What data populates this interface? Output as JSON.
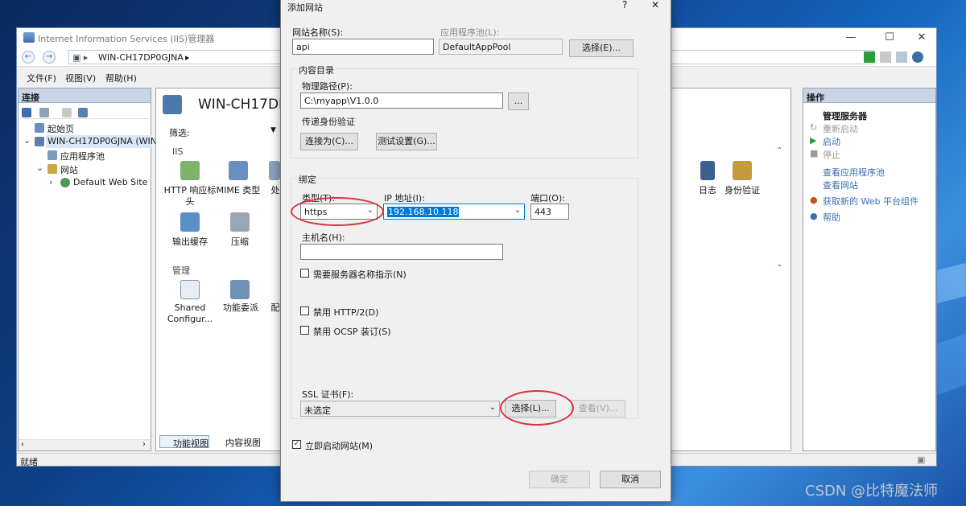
{
  "window": {
    "title": "Internet Information Services (IIS)管理器",
    "address_parts": [
      "WIN-CH17DP0GJNA"
    ],
    "menu": [
      "文件(F)",
      "视图(V)",
      "帮助(H)"
    ]
  },
  "connections": {
    "title": "连接",
    "tree": [
      {
        "label": "起始页"
      },
      {
        "label": "WIN-CH17DP0GJNA (WIN-"
      },
      {
        "label": "应用程序池"
      },
      {
        "label": "网站"
      },
      {
        "label": "Default Web Site"
      }
    ]
  },
  "center": {
    "title": "WIN-CH17DP",
    "filter_label": "筛选:",
    "group_iis": "IIS",
    "group_manage": "管理",
    "features": [
      {
        "label": "HTTP 响应标头"
      },
      {
        "label": "MIME 类型"
      },
      {
        "label": "处"
      },
      {
        "label": "输出缓存"
      },
      {
        "label": "压缩"
      },
      {
        "label": "日志"
      },
      {
        "label": "身份验证"
      },
      {
        "label": "Shared Configur..."
      },
      {
        "label": "功能委派"
      },
      {
        "label": "配"
      }
    ],
    "tabs": [
      "功能视图",
      "内容视图"
    ]
  },
  "actions": {
    "title": "操作",
    "manage_server": "管理服务器",
    "restart": "重新启动",
    "start": "启动",
    "stop": "停止",
    "view_app_pools": "查看应用程序池",
    "view_sites": "查看网站",
    "get_new": "获取新的 Web 平台组件",
    "help": "帮助"
  },
  "status": {
    "text": "就绪"
  },
  "dialog": {
    "title": "添加网站",
    "help": "?",
    "close": "✕",
    "site_name_label": "网站名称(S):",
    "site_name_value": "api",
    "app_pool_label": "应用程序池(L):",
    "app_pool_value": "DefaultAppPool",
    "select_e": "选择(E)...",
    "content_dir": "内容目录",
    "physical_path_label": "物理路径(P):",
    "physical_path_value": "C:\\myapp\\V1.0.0",
    "browse": "...",
    "pass_auth": "传递身份验证",
    "connect_as": "连接为(C)...",
    "test_settings": "测试设置(G)...",
    "binding": "绑定",
    "type_label": "类型(T):",
    "type_value": "https",
    "ip_label": "IP 地址(I):",
    "ip_value": "192.168.10.118",
    "port_label": "端口(O):",
    "port_value": "443",
    "host_label": "主机名(H):",
    "host_value": "",
    "sni": "需要服务器名称指示(N)",
    "disable_http2": "禁用 HTTP/2(D)",
    "disable_ocsp": "禁用 OCSP 装订(S)",
    "ssl_label": "SSL 证书(F):",
    "ssl_value": "未选定",
    "select_l": "选择(L)...",
    "view_v": "查看(V)...",
    "start_now": "立即启动网站(M)",
    "ok": "确定",
    "cancel": "取消"
  },
  "watermark": "CSDN @比特魔法师",
  "colors": {
    "highlight": "#0078d7",
    "annotation": "#d8323f",
    "pane_header": "#c9d5e6"
  }
}
